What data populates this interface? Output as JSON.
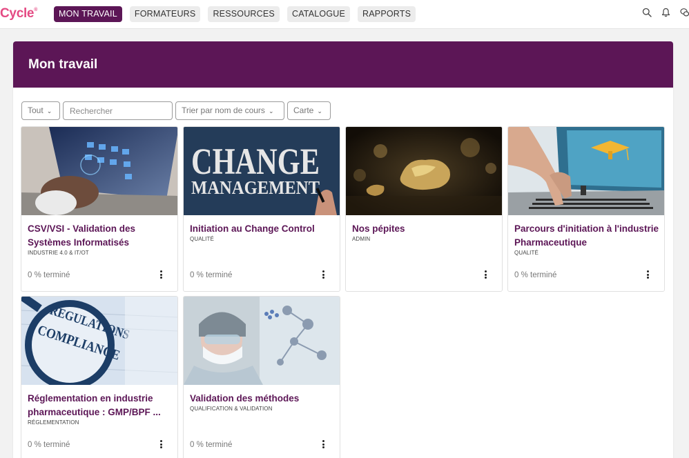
{
  "app": {
    "logo_text": "Cycle",
    "logo_mark": "®"
  },
  "nav": {
    "items": [
      {
        "label": "MON TRAVAIL",
        "active": true
      },
      {
        "label": "FORMATEURS",
        "active": false
      },
      {
        "label": "RESSOURCES",
        "active": false
      },
      {
        "label": "CATALOGUE",
        "active": false
      },
      {
        "label": "RAPPORTS",
        "active": false
      }
    ],
    "icons": [
      "search-icon",
      "bell-icon",
      "chat-icon"
    ]
  },
  "page": {
    "title": "Mon travail"
  },
  "filters": {
    "type_select": "Tout",
    "search_placeholder": "Rechercher",
    "sort_select": "Trier par nom de cours",
    "view_select": "Carte"
  },
  "courses": [
    {
      "title": "CSV/VSI - Validation des Systèmes Informatisés",
      "tag": "INDUSTRIE 4.0 & IT/OT",
      "progress": "0 % terminé",
      "image": "laptop-data-image"
    },
    {
      "title": "Initiation au Change Control",
      "tag": "QUALITÉ",
      "progress": "0 % terminé",
      "image": "change-management-image"
    },
    {
      "title": "Nos pépites",
      "tag": "ADMIN",
      "progress": "",
      "image": "gold-nugget-image"
    },
    {
      "title": "Parcours d'initiation à l'industrie Pharmaceutique",
      "tag": "QUALITÉ",
      "progress": "0 % terminé",
      "image": "laptop-graduation-image"
    },
    {
      "title": "Réglementation en industrie pharmaceutique : GMP/BPF ...",
      "tag": "RÉGLEMENTATION",
      "progress": "0 % terminé",
      "image": "regulations-compliance-image"
    },
    {
      "title": "Validation des méthodes",
      "tag": "QUALIFICATION & VALIDATION",
      "progress": "0 % terminé",
      "image": "lab-scientist-image"
    }
  ],
  "image_text": {
    "change_1": "CHANGE",
    "change_2": "MANAGEMENT",
    "reg_1": "REGULATIONS",
    "reg_2": "COMPLIANCE"
  },
  "colors": {
    "brand": "#5c1656",
    "logo": "#e44a83",
    "background": "#f2f2f2"
  }
}
